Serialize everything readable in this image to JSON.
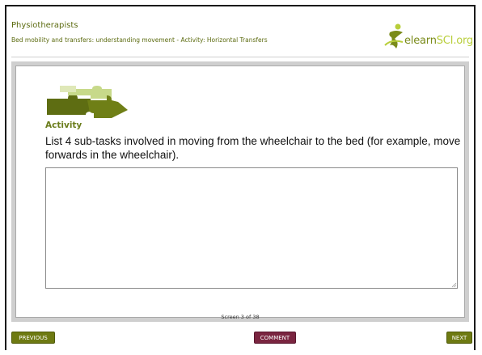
{
  "header": {
    "title": "Physiotherapists",
    "subtitle": "Bed mobility and transfers: understanding movement - Activity: Horizontal Transfers",
    "logo": {
      "prefix": "elearn",
      "highlight": "SCI",
      "suffix": ".org"
    }
  },
  "content": {
    "icon": "puzzle-pieces-icon",
    "activity_label": "Activity",
    "prompt": "List 4 sub-tasks involved in moving from the wheelchair to the bed (for example, move forwards in the wheelchair).",
    "answer": {
      "value": "",
      "placeholder": ""
    },
    "screen_counter": "Screen 3 of 38"
  },
  "footer": {
    "previous_label": "PREVIOUS",
    "comment_label": "COMMENT",
    "next_label": "NEXT"
  },
  "colors": {
    "olive": "#6e7a12",
    "maroon": "#7a2540",
    "panel_gray": "#cfcfcf",
    "logo_light": "#b8ce3a"
  }
}
